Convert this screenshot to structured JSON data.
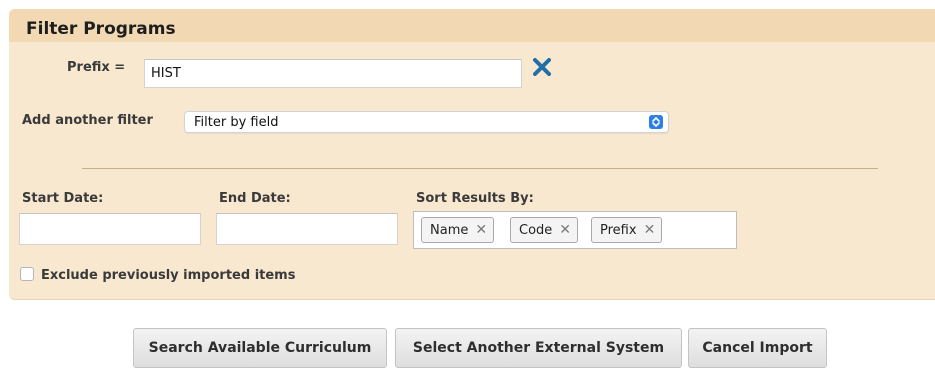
{
  "filter_panel": {
    "title": "Filter Programs",
    "prefix_label": "Prefix =",
    "prefix_value": "HIST",
    "clear_icon": "close-icon",
    "add_filter_label": "Add another filter",
    "add_filter_selected": "Filter by field",
    "start_date_label": "Start Date:",
    "start_date_value": "",
    "end_date_label": "End Date:",
    "end_date_value": "",
    "sort_label": "Sort Results By:",
    "sort_tags": [
      "Name",
      "Code",
      "Prefix"
    ],
    "tag_remove_glyph": "✕",
    "exclude_label": "Exclude previously imported items",
    "exclude_checked": false
  },
  "actions": {
    "search_label": "Search Available Curriculum",
    "select_system_label": "Select Another External System",
    "cancel_label": "Cancel Import"
  },
  "colors": {
    "panel_bg": "#f8e8d0",
    "header_bg": "#f3d9b3",
    "clear_icon": "#1f6fa8",
    "select_arrow": "#2f7fe8"
  }
}
